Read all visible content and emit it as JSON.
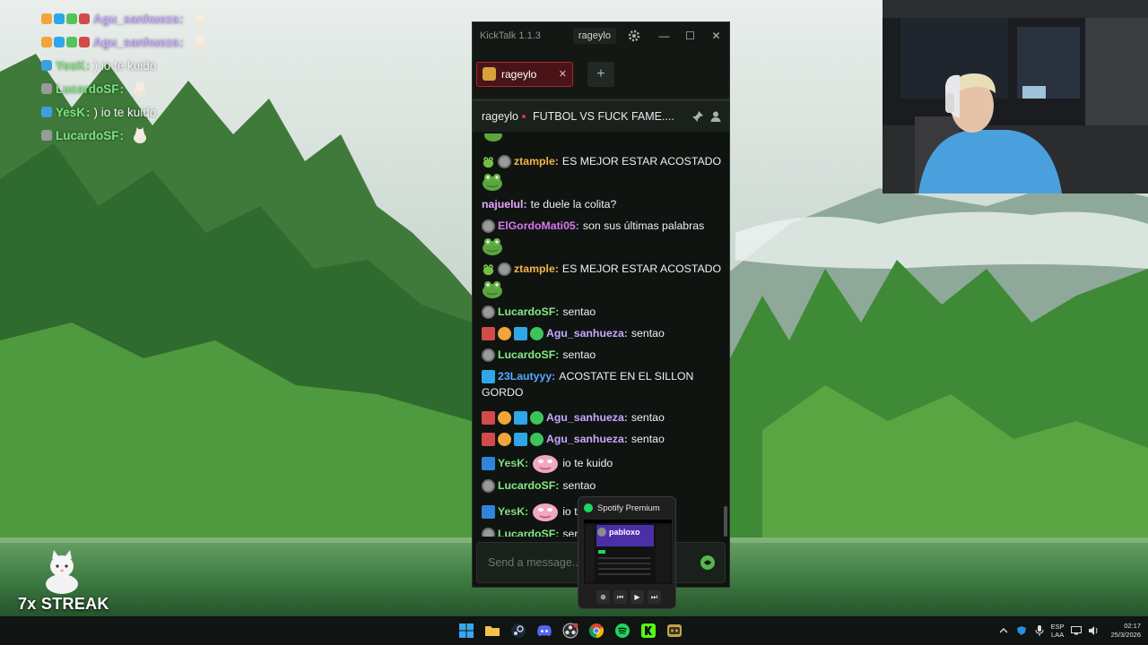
{
  "overlay_chat": [
    {
      "user": "Agu_sanhueza",
      "sep": ":",
      "msg": "",
      "color": "#c6a8ff",
      "badges": [
        "#f1a53a",
        "#2ea6e8",
        "#52c45a",
        "#d34a4a"
      ],
      "emote": true
    },
    {
      "user": "Agu_sanhueza",
      "sep": ":",
      "msg": "",
      "color": "#c6a8ff",
      "badges": [
        "#f1a53a",
        "#2ea6e8",
        "#52c45a",
        "#d34a4a"
      ],
      "emote": true
    },
    {
      "user": "YesK",
      "sep": ":",
      "msg": ") io te kuido",
      "color": "#7fe37f",
      "badges": [
        "#3aa0e0"
      ],
      "emote": false
    },
    {
      "user": "LucardoSF",
      "sep": ":",
      "msg": "",
      "color": "#7de07d",
      "badges": [
        "#9a9a9a"
      ],
      "emote": true
    },
    {
      "user": "YesK",
      "sep": ":",
      "msg": ") io te kuido",
      "color": "#7fe37f",
      "badges": [
        "#3aa0e0"
      ],
      "emote": false
    },
    {
      "user": "LucardoSF",
      "sep": ":",
      "msg": "",
      "color": "#7de07d",
      "badges": [
        "#9a9a9a"
      ],
      "emote": true
    }
  ],
  "streak": {
    "label": "7x STREAK"
  },
  "kicktalk": {
    "app_title": "KickTalk 1.1.3",
    "title_user": "rageylo",
    "tab_label": "rageylo",
    "tab_close": "✕",
    "add_tab": "+",
    "window_controls": {
      "minimize": "—",
      "maximize": "☐",
      "close": "✕"
    },
    "channel_name": "rageylo",
    "stream_title": "FUTBOL VS FUCK FAME....",
    "input_placeholder": "Send a message...",
    "messages": [
      {
        "user": "ztample",
        "text": "ES MEJOR ESTAR ACOSTADO",
        "color": "#f7b24a"
      },
      {
        "user": "najuelul",
        "text": "te duele la colita?",
        "color": "#e7a7ff"
      },
      {
        "user": "ElGordoMati05",
        "text": "son sus últimas palabras",
        "color": "#d977f0"
      },
      {
        "user": "ztample",
        "text": "ES MEJOR ESTAR ACOSTADO",
        "color": "#f7b24a"
      },
      {
        "user": "LucardoSF",
        "text": "sentao",
        "color": "#86ea86"
      },
      {
        "user": "Agu_sanhueza",
        "text": "sentao",
        "color": "#c6a8ff"
      },
      {
        "user": "LucardoSF",
        "text": "sentao",
        "color": "#86ea86"
      },
      {
        "user": "23Lautyyy",
        "text": "ACOSTATE EN EL SILLON",
        "text2": "GORDO",
        "color": "#5aa8ff"
      },
      {
        "user": "Agu_sanhueza",
        "text": "sentao",
        "color": "#c6a8ff"
      },
      {
        "user": "Agu_sanhueza",
        "text": "sentao",
        "color": "#c6a8ff"
      },
      {
        "user": "YesK",
        "text": "io te kuido",
        "color": "#7de07d"
      },
      {
        "user": "LucardoSF",
        "text": "sentao",
        "color": "#86ea86"
      },
      {
        "user": "YesK",
        "text": "io t",
        "color": "#7de07d"
      },
      {
        "user": "LucardoSF",
        "text": "sen",
        "color": "#86ea86"
      }
    ]
  },
  "spotify": {
    "title": "Spotify Premium",
    "artist": "pabloxo"
  },
  "taskbar": {
    "lang_top": "ESP",
    "lang_bottom": "LAA",
    "time": "02:17",
    "date": "25/3/2026"
  },
  "colors": {
    "kick_green": "#53fc18",
    "tab_red": "#b3242e",
    "spotify_green": "#1ed760"
  }
}
